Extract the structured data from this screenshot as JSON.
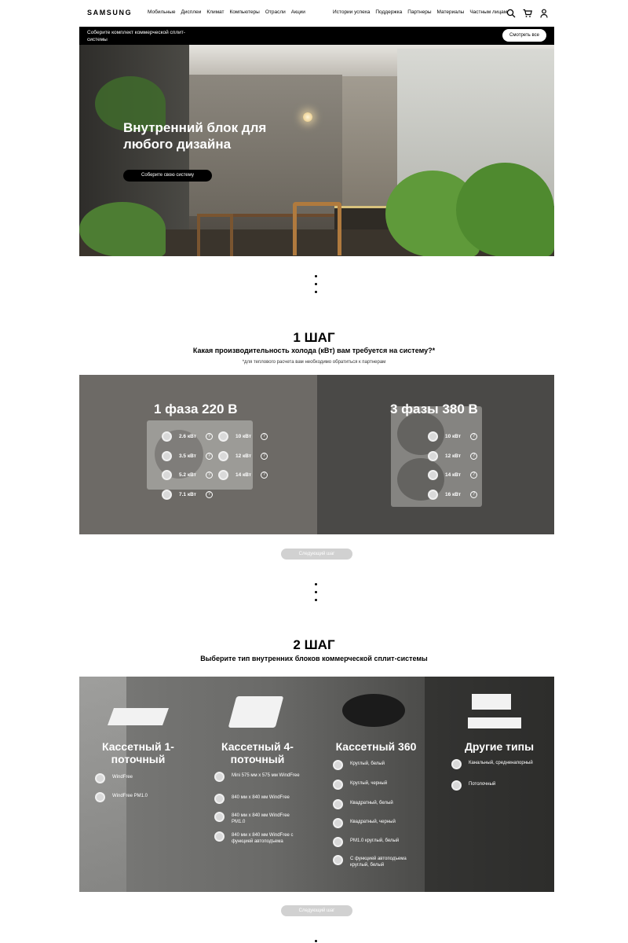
{
  "header": {
    "logo": "SAMSUNG",
    "nav_left": [
      "Мобильные",
      "Дисплеи",
      "Климат",
      "Компьютеры",
      "Отрасли",
      "Акции"
    ],
    "nav_right": [
      "Истории успеха",
      "Поддержка",
      "Партнеры",
      "Материалы",
      "Частным лицам"
    ],
    "icons": [
      "search-icon",
      "cart-icon",
      "user-icon"
    ]
  },
  "promo": {
    "text": "Соберите комплект коммерческой сплит-системы",
    "button": "Смотреть все"
  },
  "hero": {
    "title": "Внутренний блок для любого дизайна",
    "button": "Соберите свою систему"
  },
  "step1": {
    "title": "1 ШАГ",
    "question": "Какая производительность холода (кВт) вам требуется на систему?*",
    "note": "*для теплового расчета вам необходимо обратиться к партнерам",
    "single_phase": {
      "title": "1 фаза 220 В",
      "options": [
        "2.6 кВт",
        "10 кВт",
        "3.5 кВт",
        "12 кВт",
        "5.2 кВт",
        "14 кВт",
        "7.1 кВт"
      ]
    },
    "three_phase": {
      "title": "3 фазы 380 В",
      "options": [
        "10 кВт",
        "12 кВт",
        "14 кВт",
        "16 кВт"
      ]
    },
    "next": "Следующий шаг",
    "help": "?"
  },
  "step2": {
    "title": "2 ШАГ",
    "question": "Выберите тип внутренних блоков коммерческой сплит-системы",
    "columns": [
      {
        "title": "Кассетный 1-поточный",
        "options": [
          "WindFree",
          "WindFree PM1.0"
        ]
      },
      {
        "title": "Кассетный 4-поточный",
        "options": [
          "Mini 575 мм x 575 мм WindFree",
          "840 мм x 840 мм WindFree",
          "840 мм x 840 мм WindFree PM1.0",
          "840 мм x 840 мм WindFree с функцией автоподъема"
        ]
      },
      {
        "title": "Кассетный 360",
        "options": [
          "Круглый, белый",
          "Круглый, черный",
          "Квадратный, белый",
          "Квадратный, черный",
          "PM1.0 круглый, белый",
          "С функцией автоподъема круглый, белый"
        ]
      },
      {
        "title": "Другие типы",
        "options": [
          "Канальный, средненапорный",
          "Потолочный"
        ]
      }
    ],
    "next": "Следующий шаг"
  },
  "colors": {
    "step1_left_bg": "#6d6a66",
    "step1_right_bg": "#4a4947",
    "next_button": "#d1d1d1",
    "promo_bg": "#000000"
  }
}
